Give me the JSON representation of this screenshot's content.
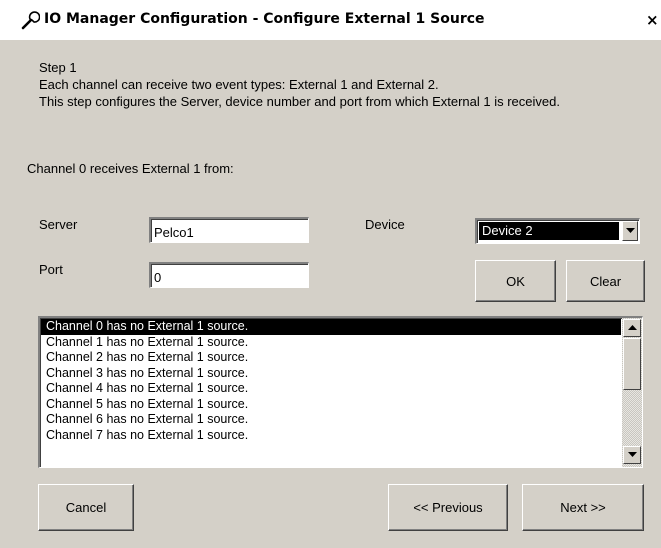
{
  "window": {
    "title": "IO Manager Configuration - Configure External 1 Source",
    "close_label": "×"
  },
  "instructions": {
    "step": "Step 1",
    "line1": "Each channel can receive two event types: External 1 and External 2.",
    "line2": "This step configures the Server, device number and port from which External 1 is received."
  },
  "channel_caption": "Channel 0 receives External 1 from:",
  "form": {
    "server_label": "Server",
    "server_value": "Pelco1",
    "device_label": "Device",
    "device_selected": "Device 2",
    "port_label": "Port",
    "port_value": "0",
    "ok_label": "OK",
    "clear_label": "Clear"
  },
  "channel_list": [
    "Channel 0 has no External 1 source.",
    "Channel 1 has no External 1 source.",
    "Channel 2 has no External 1 source.",
    "Channel 3 has no External 1 source.",
    "Channel 4 has no External 1 source.",
    "Channel 5 has no External 1 source.",
    "Channel 6 has no External 1 source.",
    "Channel 7 has no External 1 source."
  ],
  "footer": {
    "cancel_label": "Cancel",
    "previous_label": "<< Previous",
    "next_label": "Next >>"
  },
  "colors": {
    "dialog_face": "#d4d0c8",
    "selection": "#000000"
  },
  "icons": {
    "title_icon": "wrench-icon",
    "dropdown": "triangle-down-icon",
    "scroll_up": "triangle-up-icon",
    "scroll_down": "triangle-down-icon"
  }
}
